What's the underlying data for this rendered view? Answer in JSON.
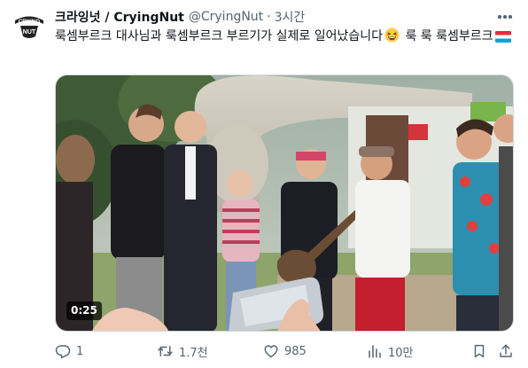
{
  "author": {
    "display_name": "크라잉넛 / CryingNut",
    "handle": "@CryingNut",
    "separator": "·",
    "time": "3시간",
    "avatar_logo_text": [
      "CRYING",
      "NUT"
    ]
  },
  "tweet": {
    "text_before_emoji": "룩셈부르크 대사님과 룩셈부르크 부르기가 실제로 일어났습니다",
    "emoji_name": "grinning-squinting-face-emoji",
    "text_after_emoji": " 룩 룩 룩셈부르크",
    "flag_name": "luxembourg-flag-emoji"
  },
  "media": {
    "type": "video",
    "duration": "0:25"
  },
  "actions": {
    "reply_count": "1",
    "retweet_count": "1.7천",
    "like_count": "985",
    "views_count": "10만"
  },
  "colors": {
    "text_primary": "#0f1419",
    "text_secondary": "#536471",
    "border": "#cfd9de",
    "flag_red": "#ed2939",
    "flag_white": "#ffffff",
    "flag_blue": "#00a1de"
  },
  "icons": {
    "more": "more-options-icon",
    "reply": "reply-icon",
    "retweet": "retweet-icon",
    "like": "heart-icon",
    "views": "views-chart-icon",
    "bookmark": "bookmark-icon",
    "share": "share-icon"
  }
}
